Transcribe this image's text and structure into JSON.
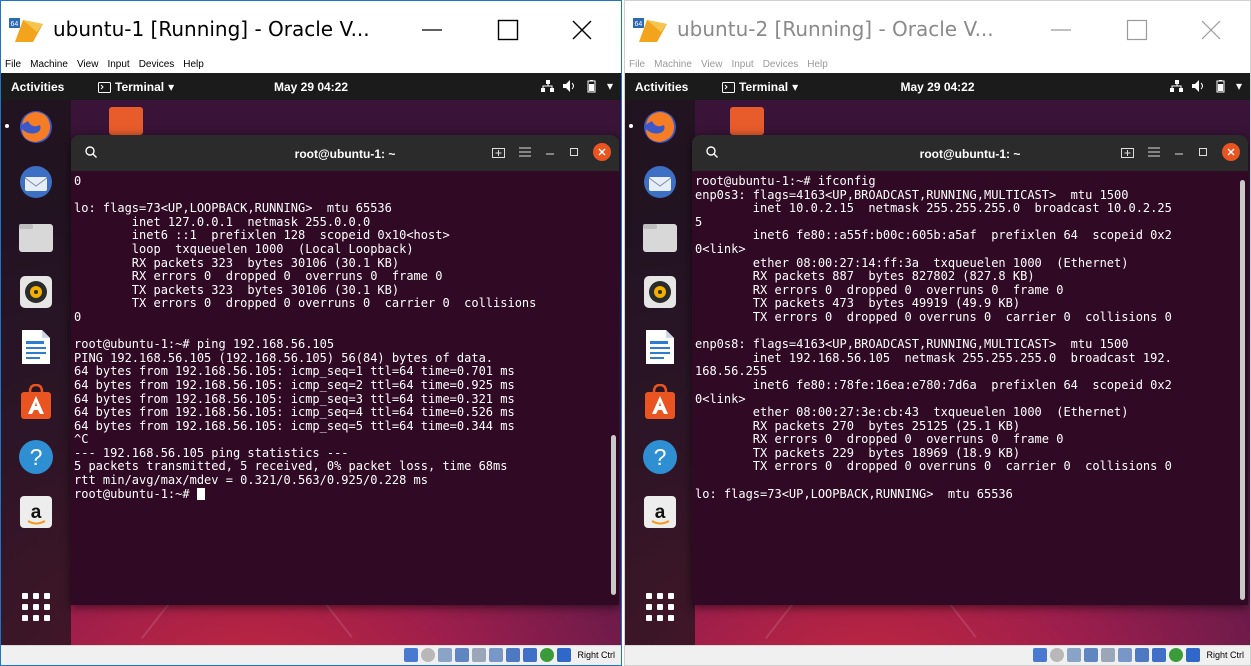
{
  "windows": [
    {
      "title": "ubuntu-1 [Running] - Oracle V...",
      "menu": [
        "File",
        "Machine",
        "View",
        "Input",
        "Devices",
        "Help"
      ],
      "guest": {
        "activities": "Activities",
        "app_menu": "Terminal",
        "clock": "May 29  04:22",
        "terminal_title": "root@ubuntu-1: ~",
        "lines": [
          "0",
          "",
          "lo: flags=73<UP,LOOPBACK,RUNNING>  mtu 65536",
          "        inet 127.0.0.1  netmask 255.0.0.0",
          "        inet6 ::1  prefixlen 128  scopeid 0x10<host>",
          "        loop  txqueuelen 1000  (Local Loopback)",
          "        RX packets 323  bytes 30106 (30.1 KB)",
          "        RX errors 0  dropped 0  overruns 0  frame 0",
          "        TX packets 323  bytes 30106 (30.1 KB)",
          "        TX errors 0  dropped 0 overruns 0  carrier 0  collisions",
          "0",
          "",
          "root@ubuntu-1:~# ping 192.168.56.105",
          "PING 192.168.56.105 (192.168.56.105) 56(84) bytes of data.",
          "64 bytes from 192.168.56.105: icmp_seq=1 ttl=64 time=0.701 ms",
          "64 bytes from 192.168.56.105: icmp_seq=2 ttl=64 time=0.925 ms",
          "64 bytes from 192.168.56.105: icmp_seq=3 ttl=64 time=0.321 ms",
          "64 bytes from 192.168.56.105: icmp_seq=4 ttl=64 time=0.526 ms",
          "64 bytes from 192.168.56.105: icmp_seq=5 ttl=64 time=0.344 ms",
          "^C",
          "--- 192.168.56.105 ping statistics ---",
          "5 packets transmitted, 5 received, 0% packet loss, time 68ms",
          "rtt min/avg/max/mdev = 0.321/0.563/0.925/0.228 ms"
        ],
        "prompt": "root@ubuntu-1:~# "
      },
      "host_key": "Right Ctrl"
    },
    {
      "title": "ubuntu-2 [Running] - Oracle V...",
      "menu": [
        "File",
        "Machine",
        "View",
        "Input",
        "Devices",
        "Help"
      ],
      "guest": {
        "activities": "Activities",
        "app_menu": "Terminal",
        "clock": "May 29  04:22",
        "terminal_title": "root@ubuntu-1: ~",
        "lines": [
          "root@ubuntu-1:~# ifconfig",
          "enp0s3: flags=4163<UP,BROADCAST,RUNNING,MULTICAST>  mtu 1500",
          "        inet 10.0.2.15  netmask 255.255.255.0  broadcast 10.0.2.25",
          "5",
          "        inet6 fe80::a55f:b00c:605b:a5af  prefixlen 64  scopeid 0x2",
          "0<link>",
          "        ether 08:00:27:14:ff:3a  txqueuelen 1000  (Ethernet)",
          "        RX packets 887  bytes 827802 (827.8 KB)",
          "        RX errors 0  dropped 0  overruns 0  frame 0",
          "        TX packets 473  bytes 49919 (49.9 KB)",
          "        TX errors 0  dropped 0 overruns 0  carrier 0  collisions 0",
          "",
          "enp0s8: flags=4163<UP,BROADCAST,RUNNING,MULTICAST>  mtu 1500",
          "        inet 192.168.56.105  netmask 255.255.255.0  broadcast 192.",
          "168.56.255",
          "        inet6 fe80::78fe:16ea:e780:7d6a  prefixlen 64  scopeid 0x2",
          "0<link>",
          "        ether 08:00:27:3e:cb:43  txqueuelen 1000  (Ethernet)",
          "        RX packets 270  bytes 25125 (25.1 KB)",
          "        RX errors 0  dropped 0  overruns 0  frame 0",
          "        TX packets 229  bytes 18969 (18.9 KB)",
          "        TX errors 0  dropped 0 overruns 0  carrier 0  collisions 0",
          "",
          "lo: flags=73<UP,LOOPBACK,RUNNING>  mtu 65536"
        ],
        "prompt": ""
      },
      "host_key": "Right Ctrl"
    }
  ],
  "dock_apps": [
    "firefox-icon",
    "thunderbird-icon",
    "files-icon",
    "rhythmbox-icon",
    "libreoffice-writer-icon",
    "software-center-icon",
    "help-icon",
    "amazon-icon"
  ],
  "colors": {
    "terminal_bg": "#300a24",
    "close_accent": "#e95420",
    "guest_topbar": "#1b1b1b"
  }
}
